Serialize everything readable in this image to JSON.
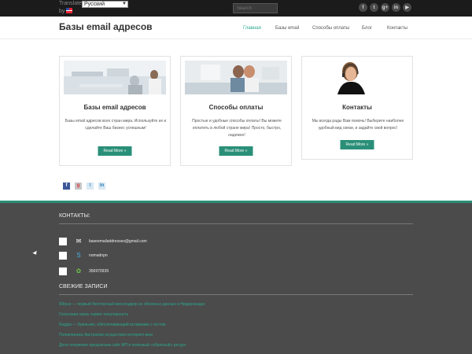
{
  "topbar": {
    "translate_label": "Translate",
    "by_label": "by",
    "language_value": "Русский",
    "search_placeholder": "Search",
    "social_icons": [
      "facebook-icon",
      "twitter-icon",
      "google-plus-icon",
      "linkedin-icon",
      "youtube-icon"
    ],
    "social_glyphs": [
      "f",
      "t",
      "g+",
      "in",
      "▶"
    ]
  },
  "header": {
    "logo": "Базы email адресов",
    "nav": [
      "Главная",
      "Базы email",
      "Способы оплаты",
      "Блог",
      "Контакты"
    ]
  },
  "cards": [
    {
      "title": "Базы email адресов",
      "text": "Базы email адресов всех стран мира. Используйте их и сделайте Ваш бизнес успешным!",
      "button": "Read More »"
    },
    {
      "title": "Способы оплаты",
      "text": "Простые и удобные способы оплаты! Вы можете оплатить в любой стране мира! Просто, быстро, надежно!",
      "button": "Read More »"
    },
    {
      "title": "Контакты",
      "text": "Мы всегда рады Вам помочь! Выберите наиболее удобный вид связи, и задайте свой вопрос!",
      "button": "Read More »"
    }
  ],
  "share_icons": [
    "facebook-share-icon",
    "google-plus-share-icon",
    "twitter-share-icon",
    "linkedin-share-icon"
  ],
  "footer": {
    "contacts_heading": "КОНТАКТЫ:",
    "contacts": [
      {
        "icon": "email-icon",
        "text": "baseemailaddresses@gmail.com"
      },
      {
        "icon": "skype-icon",
        "text": "nomadnpn"
      },
      {
        "icon": "icq-icon",
        "text": "356970939"
      }
    ],
    "posts_heading": "СВЕЖИЕ ЗАПИСИ",
    "posts": [
      "Wbyuo — первый бесплатный мессенджер из облачных данных в Нидерландах",
      "Голосовая связь теряет популярность",
      "Ruggia — бумльник, обеспечивающий вставками с тестом",
      "Поликлиника Австралии осуществил интернет-мни",
      "Дело почувевее предлагаем сайт МП в полезный «обратный» ресурс"
    ]
  },
  "colors": {
    "accent": "#2a8f78",
    "topbar_bg": "#1b1b1b",
    "footer_bg": "#4b4b4b"
  }
}
